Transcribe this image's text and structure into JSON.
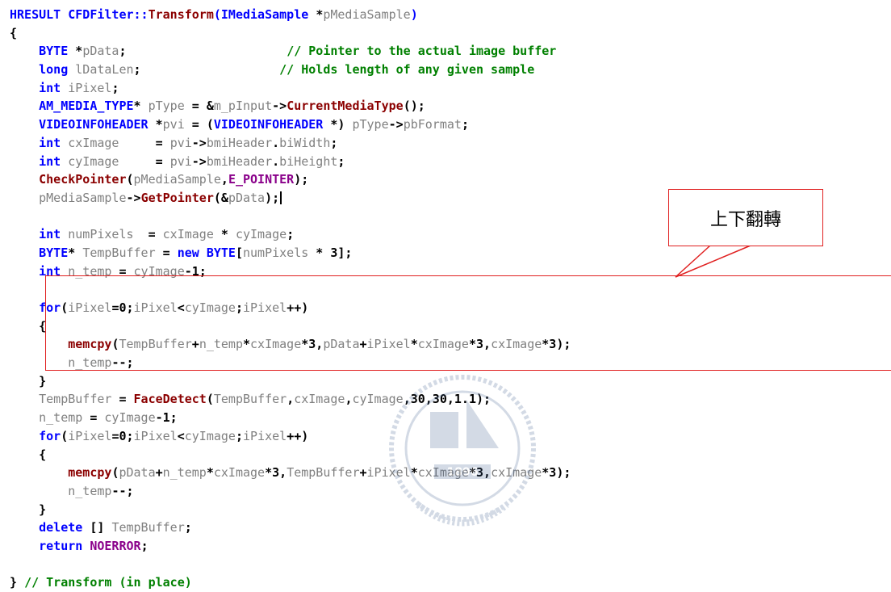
{
  "code_lines": [
    {
      "indent": "",
      "tokens": [
        {
          "cls": "k",
          "text": "HRESULT CFDFilter::"
        },
        {
          "cls": "f",
          "text": "Transform"
        },
        {
          "cls": "k",
          "text": "(IMediaSample "
        },
        {
          "cls": "p",
          "text": "*"
        },
        {
          "cls": "t",
          "text": "pMediaSample"
        },
        {
          "cls": "k",
          "text": ")"
        }
      ]
    },
    {
      "indent": "",
      "tokens": [
        {
          "cls": "p",
          "text": "{"
        }
      ]
    },
    {
      "indent": "    ",
      "tokens": [
        {
          "cls": "k",
          "text": "BYTE "
        },
        {
          "cls": "p",
          "text": "*"
        },
        {
          "cls": "t",
          "text": "pData"
        },
        {
          "cls": "p",
          "text": ";                      "
        },
        {
          "cls": "c",
          "text": "// Pointer to the actual image buffer"
        }
      ]
    },
    {
      "indent": "    ",
      "tokens": [
        {
          "cls": "k",
          "text": "long "
        },
        {
          "cls": "t",
          "text": "lDataLen"
        },
        {
          "cls": "p",
          "text": ";                   "
        },
        {
          "cls": "c",
          "text": "// Holds length of any given sample"
        }
      ]
    },
    {
      "indent": "    ",
      "tokens": [
        {
          "cls": "k",
          "text": "int "
        },
        {
          "cls": "t",
          "text": "iPixel"
        },
        {
          "cls": "p",
          "text": ";"
        }
      ]
    },
    {
      "indent": "    ",
      "tokens": [
        {
          "cls": "k",
          "text": "AM_MEDIA_TYPE"
        },
        {
          "cls": "p",
          "text": "* "
        },
        {
          "cls": "t",
          "text": "pType"
        },
        {
          "cls": "p",
          "text": " = &"
        },
        {
          "cls": "t",
          "text": "m_pInput"
        },
        {
          "cls": "p",
          "text": "->"
        },
        {
          "cls": "f",
          "text": "CurrentMediaType"
        },
        {
          "cls": "p",
          "text": "();"
        }
      ]
    },
    {
      "indent": "    ",
      "tokens": [
        {
          "cls": "k",
          "text": "VIDEOINFOHEADER "
        },
        {
          "cls": "p",
          "text": "*"
        },
        {
          "cls": "t",
          "text": "pvi"
        },
        {
          "cls": "p",
          "text": " = ("
        },
        {
          "cls": "k",
          "text": "VIDEOINFOHEADER "
        },
        {
          "cls": "p",
          "text": "*) "
        },
        {
          "cls": "t",
          "text": "pType"
        },
        {
          "cls": "p",
          "text": "->"
        },
        {
          "cls": "t",
          "text": "pbFormat"
        },
        {
          "cls": "p",
          "text": ";"
        }
      ]
    },
    {
      "indent": "    ",
      "tokens": [
        {
          "cls": "k",
          "text": "int "
        },
        {
          "cls": "t",
          "text": "cxImage"
        },
        {
          "cls": "p",
          "text": "     = "
        },
        {
          "cls": "t",
          "text": "pvi"
        },
        {
          "cls": "p",
          "text": "->"
        },
        {
          "cls": "t",
          "text": "bmiHeader"
        },
        {
          "cls": "p",
          "text": "."
        },
        {
          "cls": "t",
          "text": "biWidth"
        },
        {
          "cls": "p",
          "text": ";"
        }
      ]
    },
    {
      "indent": "    ",
      "tokens": [
        {
          "cls": "k",
          "text": "int "
        },
        {
          "cls": "t",
          "text": "cyImage"
        },
        {
          "cls": "p",
          "text": "     = "
        },
        {
          "cls": "t",
          "text": "pvi"
        },
        {
          "cls": "p",
          "text": "->"
        },
        {
          "cls": "t",
          "text": "bmiHeader"
        },
        {
          "cls": "p",
          "text": "."
        },
        {
          "cls": "t",
          "text": "biHeight"
        },
        {
          "cls": "p",
          "text": ";"
        }
      ]
    },
    {
      "indent": "    ",
      "tokens": [
        {
          "cls": "f",
          "text": "CheckPointer"
        },
        {
          "cls": "p",
          "text": "("
        },
        {
          "cls": "t",
          "text": "pMediaSample"
        },
        {
          "cls": "p",
          "text": ","
        },
        {
          "cls": "m",
          "text": "E_POINTER"
        },
        {
          "cls": "p",
          "text": ");"
        }
      ]
    },
    {
      "indent": "    ",
      "tokens": [
        {
          "cls": "t",
          "text": "pMediaSample"
        },
        {
          "cls": "p",
          "text": "->"
        },
        {
          "cls": "f",
          "text": "GetPointer"
        },
        {
          "cls": "p",
          "text": "(&"
        },
        {
          "cls": "t",
          "text": "pData"
        },
        {
          "cls": "p",
          "text": ");"
        }
      ],
      "caret": true
    },
    {
      "indent": "",
      "tokens": []
    },
    {
      "indent": "    ",
      "tokens": [
        {
          "cls": "k",
          "text": "int "
        },
        {
          "cls": "t",
          "text": "numPixels"
        },
        {
          "cls": "p",
          "text": "  = "
        },
        {
          "cls": "t",
          "text": "cxImage"
        },
        {
          "cls": "p",
          "text": " * "
        },
        {
          "cls": "t",
          "text": "cyImage"
        },
        {
          "cls": "p",
          "text": ";"
        }
      ]
    },
    {
      "indent": "    ",
      "tokens": [
        {
          "cls": "k",
          "text": "BYTE"
        },
        {
          "cls": "p",
          "text": "* "
        },
        {
          "cls": "t",
          "text": "TempBuffer"
        },
        {
          "cls": "p",
          "text": " = "
        },
        {
          "cls": "k",
          "text": "new BYTE"
        },
        {
          "cls": "p",
          "text": "["
        },
        {
          "cls": "t",
          "text": "numPixels"
        },
        {
          "cls": "p",
          "text": " * 3];"
        }
      ]
    },
    {
      "indent": "    ",
      "tokens": [
        {
          "cls": "k",
          "text": "int "
        },
        {
          "cls": "t",
          "text": "n_temp"
        },
        {
          "cls": "p",
          "text": " = "
        },
        {
          "cls": "t",
          "text": "cyImage"
        },
        {
          "cls": "p",
          "text": "-1;"
        }
      ]
    },
    {
      "indent": "",
      "tokens": []
    },
    {
      "indent": "    ",
      "tokens": [
        {
          "cls": "k",
          "text": "for"
        },
        {
          "cls": "p",
          "text": "("
        },
        {
          "cls": "t",
          "text": "iPixel"
        },
        {
          "cls": "p",
          "text": "=0;"
        },
        {
          "cls": "t",
          "text": "iPixel"
        },
        {
          "cls": "p",
          "text": "<"
        },
        {
          "cls": "t",
          "text": "cyImage"
        },
        {
          "cls": "p",
          "text": ";"
        },
        {
          "cls": "t",
          "text": "iPixel"
        },
        {
          "cls": "p",
          "text": "++)"
        }
      ]
    },
    {
      "indent": "    ",
      "tokens": [
        {
          "cls": "p",
          "text": "{"
        }
      ]
    },
    {
      "indent": "        ",
      "tokens": [
        {
          "cls": "f",
          "text": "memcpy"
        },
        {
          "cls": "p",
          "text": "("
        },
        {
          "cls": "t",
          "text": "TempBuffer"
        },
        {
          "cls": "p",
          "text": "+"
        },
        {
          "cls": "t",
          "text": "n_temp"
        },
        {
          "cls": "p",
          "text": "*"
        },
        {
          "cls": "t",
          "text": "cxImage"
        },
        {
          "cls": "p",
          "text": "*3,"
        },
        {
          "cls": "t",
          "text": "pData"
        },
        {
          "cls": "p",
          "text": "+"
        },
        {
          "cls": "t",
          "text": "iPixel"
        },
        {
          "cls": "p",
          "text": "*"
        },
        {
          "cls": "t",
          "text": "cxImage"
        },
        {
          "cls": "p",
          "text": "*3,"
        },
        {
          "cls": "t",
          "text": "cxImage"
        },
        {
          "cls": "p",
          "text": "*3);"
        }
      ]
    },
    {
      "indent": "        ",
      "tokens": [
        {
          "cls": "t",
          "text": "n_temp"
        },
        {
          "cls": "p",
          "text": "--;"
        }
      ]
    },
    {
      "indent": "    ",
      "tokens": [
        {
          "cls": "p",
          "text": "}"
        }
      ]
    },
    {
      "indent": "    ",
      "tokens": [
        {
          "cls": "t",
          "text": "TempBuffer"
        },
        {
          "cls": "p",
          "text": " = "
        },
        {
          "cls": "f",
          "text": "FaceDetect"
        },
        {
          "cls": "p",
          "text": "("
        },
        {
          "cls": "t",
          "text": "TempBuffer"
        },
        {
          "cls": "p",
          "text": ","
        },
        {
          "cls": "t",
          "text": "cxImage"
        },
        {
          "cls": "p",
          "text": ","
        },
        {
          "cls": "t",
          "text": "cyImage"
        },
        {
          "cls": "p",
          "text": ",30,30,1.1);"
        }
      ]
    },
    {
      "indent": "    ",
      "tokens": [
        {
          "cls": "t",
          "text": "n_temp"
        },
        {
          "cls": "p",
          "text": " = "
        },
        {
          "cls": "t",
          "text": "cyImage"
        },
        {
          "cls": "p",
          "text": "-1;"
        }
      ]
    },
    {
      "indent": "    ",
      "tokens": [
        {
          "cls": "k",
          "text": "for"
        },
        {
          "cls": "p",
          "text": "("
        },
        {
          "cls": "t",
          "text": "iPixel"
        },
        {
          "cls": "p",
          "text": "=0;"
        },
        {
          "cls": "t",
          "text": "iPixel"
        },
        {
          "cls": "p",
          "text": "<"
        },
        {
          "cls": "t",
          "text": "cyImage"
        },
        {
          "cls": "p",
          "text": ";"
        },
        {
          "cls": "t",
          "text": "iPixel"
        },
        {
          "cls": "p",
          "text": "++)"
        }
      ]
    },
    {
      "indent": "    ",
      "tokens": [
        {
          "cls": "p",
          "text": "{"
        }
      ]
    },
    {
      "indent": "        ",
      "tokens": [
        {
          "cls": "f",
          "text": "memcpy"
        },
        {
          "cls": "p",
          "text": "("
        },
        {
          "cls": "t",
          "text": "pData"
        },
        {
          "cls": "p",
          "text": "+"
        },
        {
          "cls": "t",
          "text": "n_temp"
        },
        {
          "cls": "p",
          "text": "*"
        },
        {
          "cls": "t",
          "text": "cxImage"
        },
        {
          "cls": "p",
          "text": "*3,"
        },
        {
          "cls": "t",
          "text": "TempBuffer"
        },
        {
          "cls": "p",
          "text": "+"
        },
        {
          "cls": "t",
          "text": "iPixel"
        },
        {
          "cls": "p",
          "text": "*"
        },
        {
          "cls": "t",
          "text": "cxImage"
        },
        {
          "cls": "p",
          "text": "*3,"
        },
        {
          "cls": "t",
          "text": "cxImage"
        },
        {
          "cls": "p",
          "text": "*3);"
        }
      ]
    },
    {
      "indent": "        ",
      "tokens": [
        {
          "cls": "t",
          "text": "n_temp"
        },
        {
          "cls": "p",
          "text": "--;"
        }
      ]
    },
    {
      "indent": "    ",
      "tokens": [
        {
          "cls": "p",
          "text": "}"
        }
      ]
    },
    {
      "indent": "    ",
      "tokens": [
        {
          "cls": "k",
          "text": "delete "
        },
        {
          "cls": "p",
          "text": "[] "
        },
        {
          "cls": "t",
          "text": "TempBuffer"
        },
        {
          "cls": "p",
          "text": ";"
        }
      ]
    },
    {
      "indent": "    ",
      "tokens": [
        {
          "cls": "k",
          "text": "return "
        },
        {
          "cls": "m",
          "text": "NOERROR"
        },
        {
          "cls": "p",
          "text": ";"
        }
      ]
    },
    {
      "indent": "",
      "tokens": []
    },
    {
      "indent": "",
      "tokens": [
        {
          "cls": "p",
          "text": "} "
        },
        {
          "cls": "c",
          "text": "// Transform (in place)"
        }
      ]
    }
  ],
  "annotation": {
    "callout_text": "上下翻轉",
    "highlight_color": "#e02020"
  },
  "watermark": {
    "year": "1896",
    "icon": "university-seal-icon"
  },
  "colors": {
    "keyword": "#0000ff",
    "identifier": "#808080",
    "function": "#8b0000",
    "macro": "#8a008a",
    "comment": "#008000"
  }
}
